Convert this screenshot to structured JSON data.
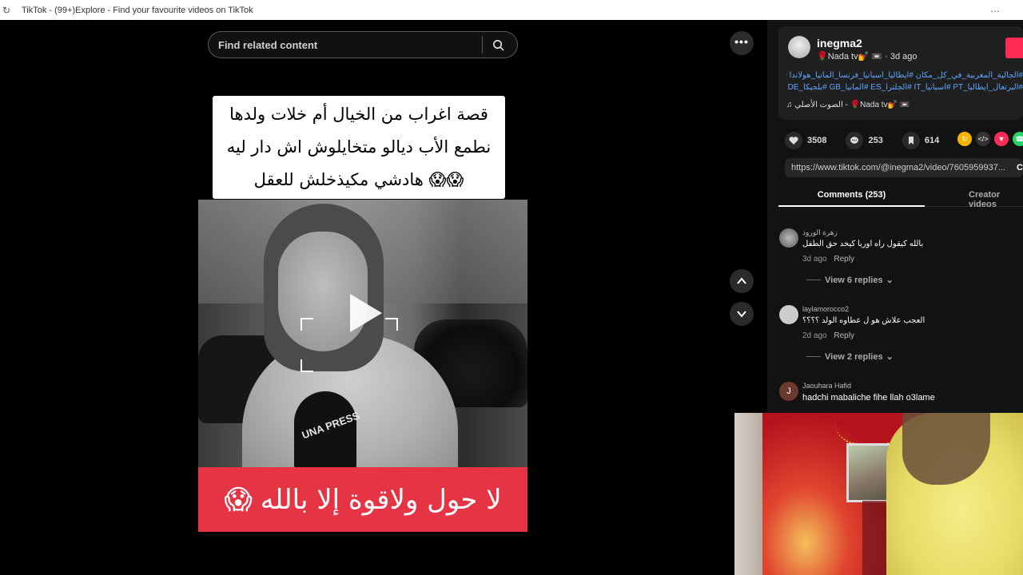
{
  "browser": {
    "tab_title": "TikTok - (99+)Explore - Find your favourite videos on TikTok",
    "menu_icon": "ellipsis-icon"
  },
  "search": {
    "placeholder": "Find related content"
  },
  "video": {
    "caption_lines": [
      "قصة اغراب من الخيال أم خلات ولدها",
      "نطمع الأب ديالو متخايلوش اش دار ليه",
      "😱😱 هادشي مكيذخلش للعقل"
    ],
    "bottom_banner": "لا حول ولاقوة إلا بالله",
    "bottom_banner_emoji": "😱",
    "mic_logo": "UNA PRESS"
  },
  "post": {
    "username": "inegma2",
    "display_meta": "🌹Nada tv💅 📼 · 3d ago",
    "hashtags_line1": "#الجالية_المغربية_في_كل_مكان #ايطاليا_اسبانيا_فرنسا_المانيا_هولاندا #MAMA",
    "hashtags_line2": "#البرتغال_ايطاليا_PT #اسبانيا_IT #الجلترا_ES #المانيا_GB #بلجيكا_DE #فرنسا_CP",
    "music": "♫ الصوت الأصلي - 🌹Nada tv💅 📼"
  },
  "stats": {
    "likes": "3508",
    "comments": "253",
    "saves": "614"
  },
  "share_url": "https://www.tiktok.com/@inegma2/video/7605959937...",
  "copy_label": "C",
  "tabs": {
    "comments": "Comments (253)",
    "creator": "Creator videos"
  },
  "comments": [
    {
      "name": "زهرة الورود",
      "text": "بالله كيقول راه اوربا كيخد حق الطفل",
      "time": "3d ago",
      "reply": "Reply",
      "view_replies": "View 6 replies"
    },
    {
      "name": "laylamorocco2",
      "text": "العجب علاش هو ل عطاوه الولد ؟؟؟؟",
      "time": "2d ago",
      "reply": "Reply",
      "view_replies": "View 2 replies"
    },
    {
      "name": "Jaouhara Hafid",
      "text": "hadchi mabaliche fihe llah o3lame",
      "avatar_letter": "J"
    }
  ],
  "colors": {
    "accent": "#fe2c55",
    "banner_red": "#e53443",
    "link_blue": "#5ea6ff"
  }
}
